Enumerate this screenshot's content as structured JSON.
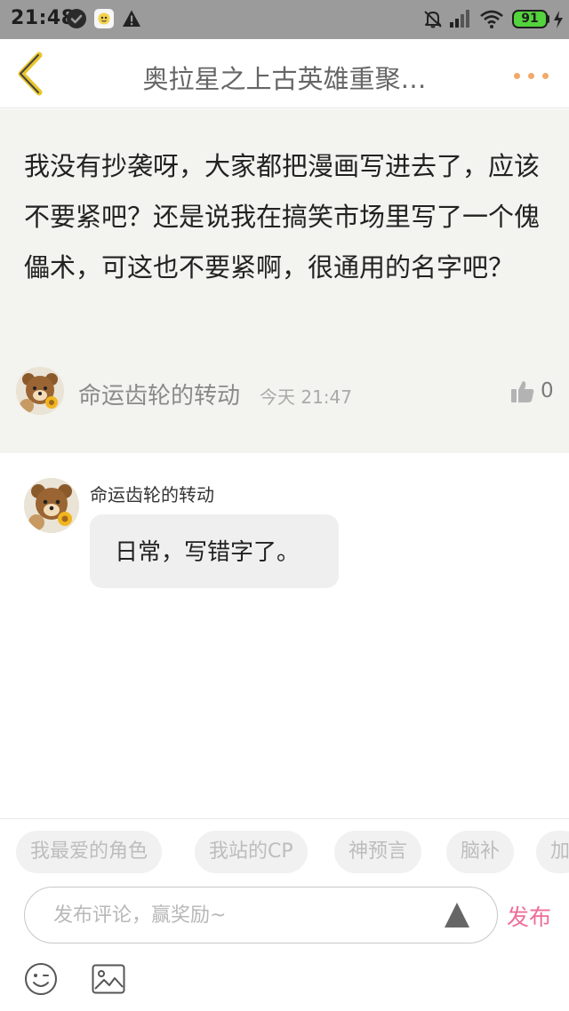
{
  "status_bar": {
    "time": "21:48",
    "battery": "91",
    "icons": [
      "check-circle-icon",
      "app-notification-icon",
      "warning-icon",
      "bell-muted-icon",
      "signal-icon",
      "wifi-icon",
      "battery-icon",
      "charging-icon"
    ]
  },
  "header": {
    "title": "奥拉星之上古英雄重聚…",
    "back_icon": "chevron-left-icon",
    "more_icon": "more-dots-icon"
  },
  "post": {
    "content": "我没有抄袭呀，大家都把漫画写进去了，应该不要紧吧？还是说我在搞笑市场里写了一个傀儡术，可这也不要紧啊，很通用的名字吧？",
    "author": "命运齿轮的转动",
    "time": "今天 21:47",
    "likes": "0"
  },
  "reply": {
    "author": "命运齿轮的转动",
    "text": "日常，写错字了。"
  },
  "tags": [
    {
      "label": "我最爱的角色"
    },
    {
      "label": "我站的CP"
    },
    {
      "label": "神预言"
    },
    {
      "label": "脑补"
    },
    {
      "label": "加"
    }
  ],
  "composer": {
    "placeholder": "发布评论，赢奖励~",
    "send_label": "发布"
  },
  "colors": {
    "accent_pink": "#ee6d9a",
    "back_yellow": "#e8c52a",
    "dots_orange": "#f3a96a",
    "post_bg": "#f3f3ef"
  }
}
